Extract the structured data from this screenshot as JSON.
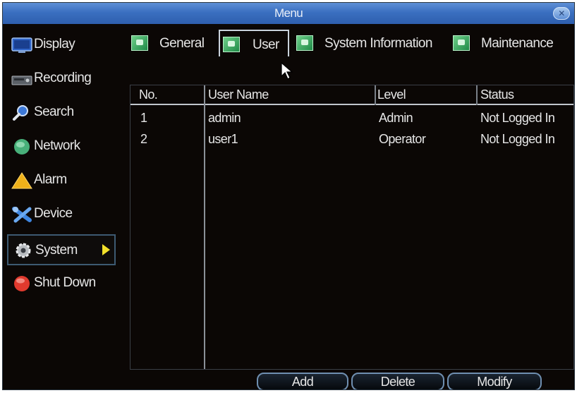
{
  "window": {
    "title": "Menu",
    "close_icon": "close-icon"
  },
  "sidebar": {
    "items": [
      {
        "label": "Display",
        "icon": "monitor-icon"
      },
      {
        "label": "Recording",
        "icon": "recorder-icon"
      },
      {
        "label": "Search",
        "icon": "magnifier-icon"
      },
      {
        "label": "Network",
        "icon": "globe-icon"
      },
      {
        "label": "Alarm",
        "icon": "warning-icon"
      },
      {
        "label": "Device",
        "icon": "tools-icon"
      },
      {
        "label": "System",
        "icon": "gear-icon",
        "active": true
      },
      {
        "label": "Shut Down",
        "icon": "power-icon"
      }
    ]
  },
  "tabs": [
    {
      "label": "General"
    },
    {
      "label": "User",
      "active": true
    },
    {
      "label": "System Information"
    },
    {
      "label": "Maintenance"
    }
  ],
  "table": {
    "columns": [
      "No.",
      "User Name",
      "Level",
      "Status"
    ],
    "rows": [
      {
        "no": "1",
        "user": "admin",
        "level": "Admin",
        "status": "Not Logged In"
      },
      {
        "no": "2",
        "user": "user1",
        "level": "Operator",
        "status": "Not Logged In"
      }
    ]
  },
  "buttons": {
    "add": "Add",
    "delete": "Delete",
    "modify": "Modify"
  },
  "colors": {
    "titlebar": "#3a6fc0",
    "background": "#0b0705",
    "accent_arrow": "#f2e02a"
  }
}
